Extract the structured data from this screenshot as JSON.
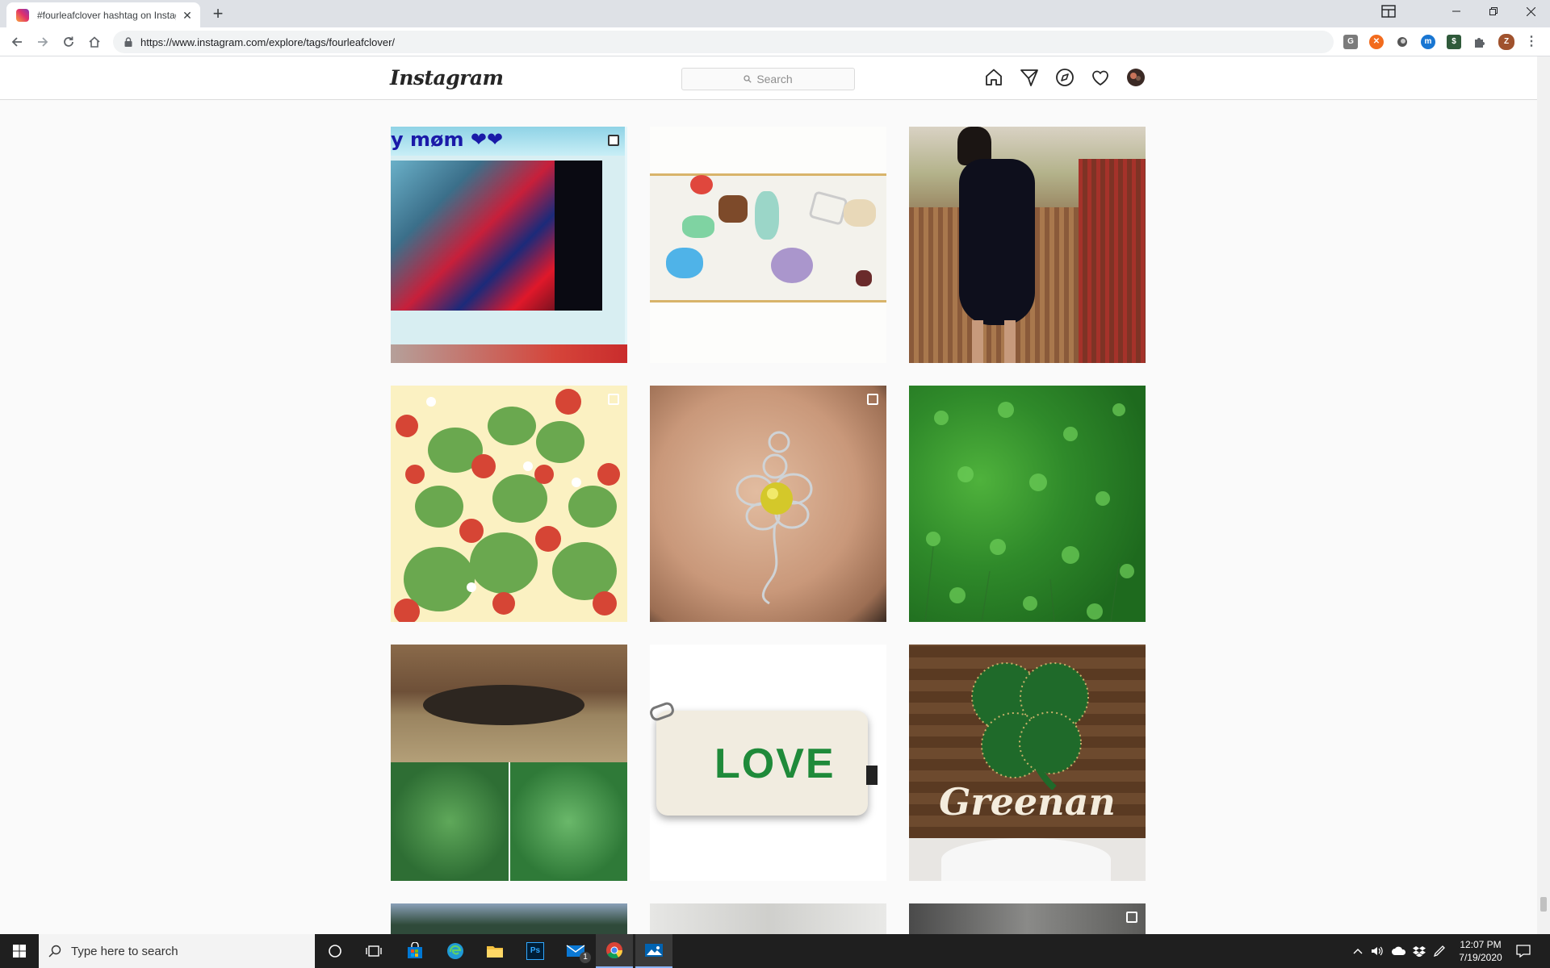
{
  "browser": {
    "tab_title": "#fourleafclover hashtag on Instag",
    "url": "https://www.instagram.com/explore/tags/fourleafclover/"
  },
  "instagram": {
    "logo": "Instagram",
    "search_placeholder": "Search"
  },
  "tiles": {
    "row1": [
      {
        "name": "video-mom-post",
        "overlay_text": "y møm ❤❤",
        "has_badge": true
      },
      {
        "name": "resin-jewelry-post"
      },
      {
        "name": "woman-porch-post"
      }
    ],
    "row2": [
      {
        "name": "strawberry-pattern-post",
        "has_badge": true
      },
      {
        "name": "wire-flower-pendant-post",
        "has_badge": true
      },
      {
        "name": "clover-field-post"
      }
    ],
    "row3": [
      {
        "name": "nest-and-clover-post"
      },
      {
        "name": "love-pouch-post",
        "text": "LOVE"
      },
      {
        "name": "greenan-sign-post",
        "text": "Greenan"
      }
    ]
  },
  "taskbar": {
    "search_placeholder": "Type here to search",
    "time": "12:07 PM",
    "date": "7/19/2020",
    "mail_badge": "1"
  }
}
